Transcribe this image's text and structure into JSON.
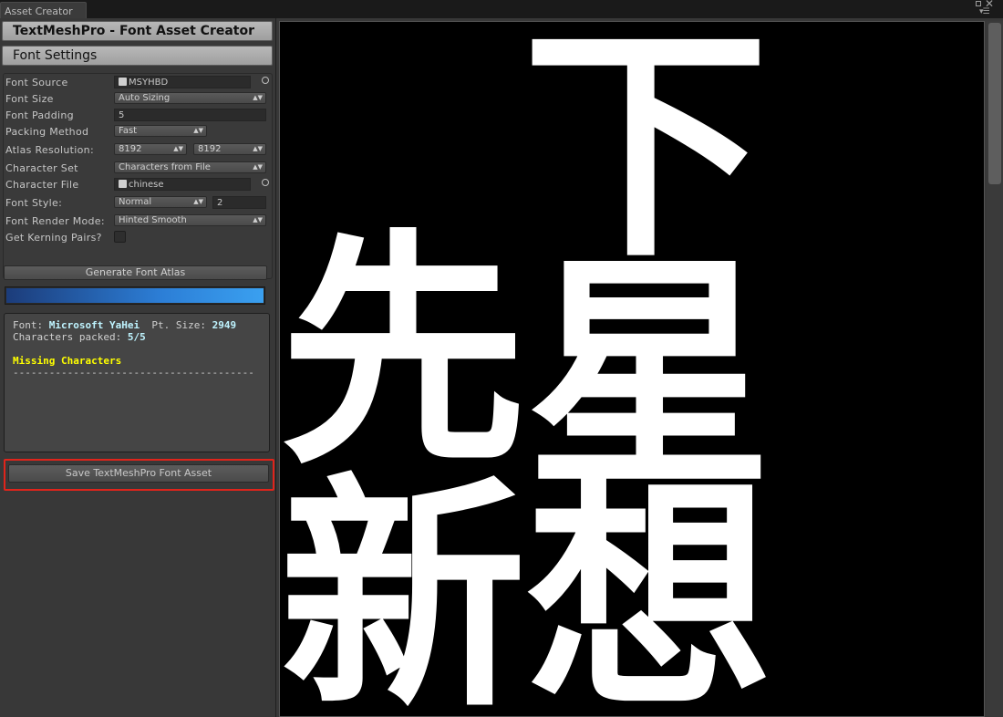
{
  "window": {
    "tab_title": "Asset Creator"
  },
  "panel": {
    "title": "TextMeshPro - Font Asset Creator",
    "section": "Font Settings"
  },
  "settings": {
    "font_source": {
      "label": "Font Source",
      "value": "MSYHBD"
    },
    "font_size": {
      "label": "Font Size",
      "value": "Auto Sizing"
    },
    "font_padding": {
      "label": "Font Padding",
      "value": "5"
    },
    "packing_method": {
      "label": "Packing Method",
      "value": "Fast"
    },
    "atlas_resolution": {
      "label": "Atlas Resolution:",
      "width": "8192",
      "height": "8192"
    },
    "character_set": {
      "label": "Character Set",
      "value": "Characters from File"
    },
    "character_file": {
      "label": "Character File",
      "value": "chinese"
    },
    "font_style": {
      "label": "Font Style:",
      "value": "Normal",
      "modifier": "2"
    },
    "font_render_mode": {
      "label": "Font Render Mode:",
      "value": "Hinted Smooth"
    },
    "kerning": {
      "label": "Get Kerning Pairs?",
      "checked": false
    }
  },
  "actions": {
    "generate": "Generate Font Atlas",
    "save": "Save TextMeshPro Font Asset"
  },
  "progress": {
    "fraction": 1.0
  },
  "output": {
    "font_label": "Font: ",
    "font_name": "Microsoft YaHei",
    "pt_label": "  Pt. Size: ",
    "pt_size": "2949",
    "packed_label": "Characters packed: ",
    "packed_value": "5/5",
    "missing_title": "Missing Characters",
    "separator": "----------------------------------------"
  },
  "atlas_glyphs": [
    "下",
    "先",
    "星",
    "新",
    "想"
  ]
}
